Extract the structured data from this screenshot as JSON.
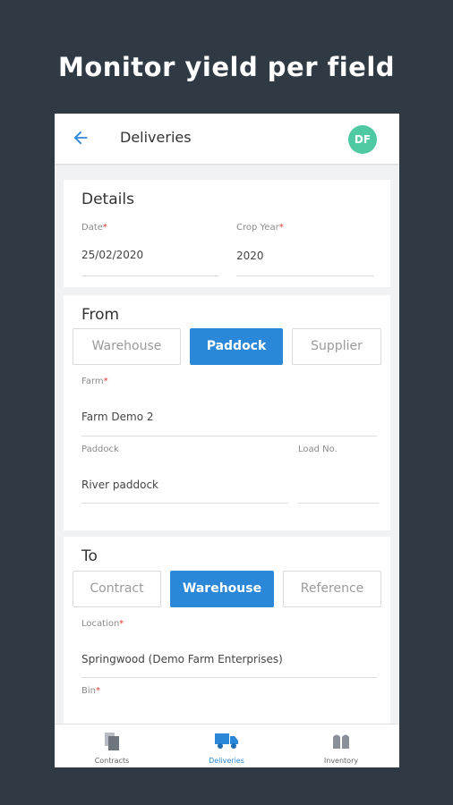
{
  "headline": "Monitor yield per field",
  "appbar": {
    "title": "Deliveries",
    "avatar": "DF"
  },
  "details": {
    "title": "Details",
    "date_label": "Date",
    "date_value": "25/02/2020",
    "crop_year_label": "Crop Year",
    "crop_year_value": "2020"
  },
  "from": {
    "title": "From",
    "tabs": [
      "Warehouse",
      "Paddock",
      "Supplier"
    ],
    "active_tab": "Paddock",
    "farm_label": "Farm",
    "farm_value": "Farm Demo 2",
    "paddock_label": "Paddock",
    "paddock_value": "River paddock",
    "load_label": "Load No.",
    "load_value": ""
  },
  "to": {
    "title": "To",
    "tabs": [
      "Contract",
      "Warehouse",
      "Reference"
    ],
    "active_tab": "Warehouse",
    "location_label": "Location",
    "location_value": "Springwood (Demo Farm Enterprises)",
    "bin_label": "Bin"
  },
  "required_marker": "*",
  "bottom_nav": [
    {
      "label": "Contracts",
      "icon": "contracts-icon",
      "active": false
    },
    {
      "label": "Deliveries",
      "icon": "truck-icon",
      "active": true
    },
    {
      "label": "Inventory",
      "icon": "silo-icon",
      "active": false
    }
  ],
  "colors": {
    "background": "#2f3a45",
    "accent": "#2b87d8",
    "avatar": "#4fc9a4",
    "required": "#e53935"
  }
}
